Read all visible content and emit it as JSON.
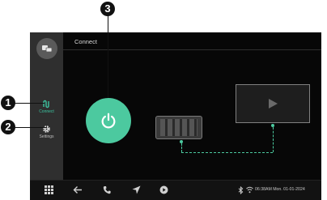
{
  "header": {
    "title": "Connect"
  },
  "sidebar": {
    "items": [
      {
        "label": "Connect",
        "icon": "connect-icon",
        "active": true
      },
      {
        "label": "Settings",
        "icon": "gear-icon",
        "active": false
      }
    ]
  },
  "status_bar": {
    "datetime": "06:38AM Mon. 01-01-2024"
  },
  "callouts": [
    "1",
    "2",
    "3"
  ],
  "colors": {
    "accent": "#4cc99f",
    "screen_bg": "#070707",
    "sidebar_bg": "#2f2f2f"
  }
}
